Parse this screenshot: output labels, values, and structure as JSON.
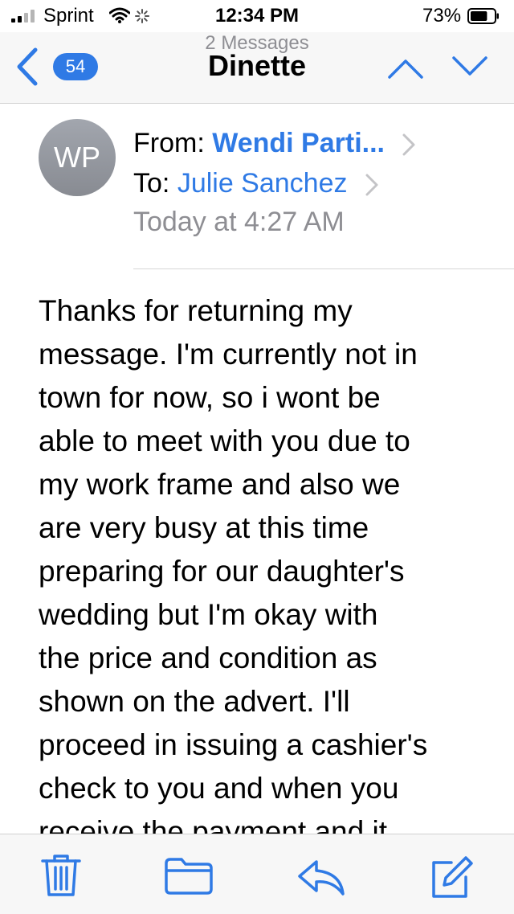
{
  "status_bar": {
    "carrier": "Sprint",
    "time": "12:34 PM",
    "battery_percent": "73%",
    "battery_level": 0.73
  },
  "nav": {
    "back_badge": "54",
    "subtitle": "2 Messages",
    "title": "Dinette",
    "icons": [
      "back-chevron-icon",
      "chevron-up-icon",
      "chevron-down-icon"
    ]
  },
  "header": {
    "avatar_initials": "WP",
    "from_label": "From:",
    "from_name": "Wendi Parti...",
    "to_label": "To:",
    "to_name": "Julie Sanchez",
    "date": "Today at 4:27 AM"
  },
  "message": {
    "body": "Thanks for returning my\nmessage. I'm currently not in\ntown for now, so i wont be\nable to meet with you due to\nmy work frame and also we\nare very busy at this time\npreparing for our daughter's\nwedding but I'm okay  with\nthe price and condition as\nshown on the advert. I'll\nproceed in issuing a cashier's\ncheck to you and when you\nreceive the payment and it"
  },
  "toolbar": {
    "icons": [
      "trash-icon",
      "folder-icon",
      "reply-icon",
      "compose-icon"
    ]
  },
  "colors": {
    "accent": "#2f7ae5",
    "secondary_text": "#8e8e93",
    "bar_background": "#f7f7f7"
  }
}
